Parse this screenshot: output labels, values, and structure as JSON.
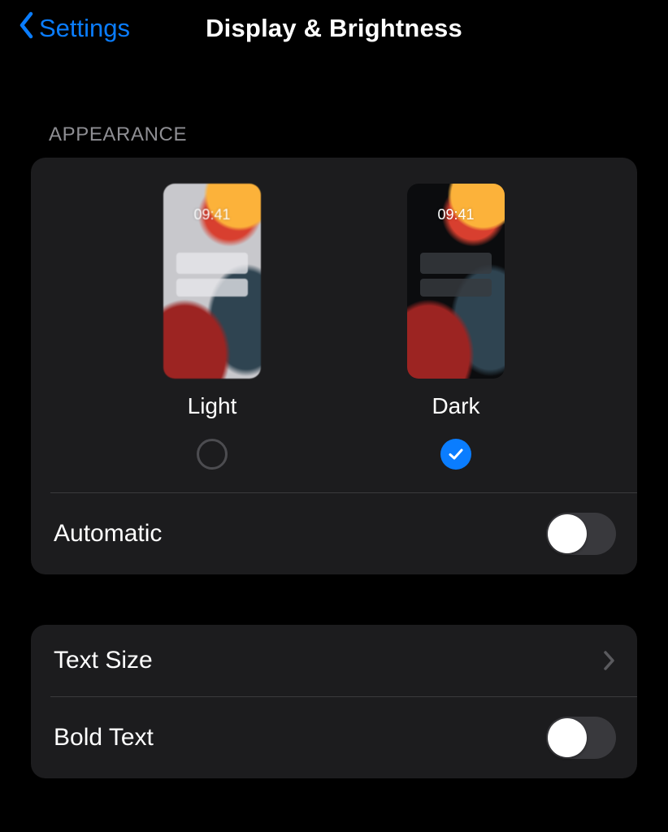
{
  "nav": {
    "back_label": "Settings",
    "title": "Display & Brightness"
  },
  "appearance": {
    "section_header": "APPEARANCE",
    "preview_time": "09:41",
    "light_label": "Light",
    "dark_label": "Dark",
    "selected": "dark"
  },
  "rows": {
    "automatic_label": "Automatic",
    "automatic_on": false,
    "text_size_label": "Text Size",
    "bold_text_label": "Bold Text",
    "bold_text_on": false
  }
}
